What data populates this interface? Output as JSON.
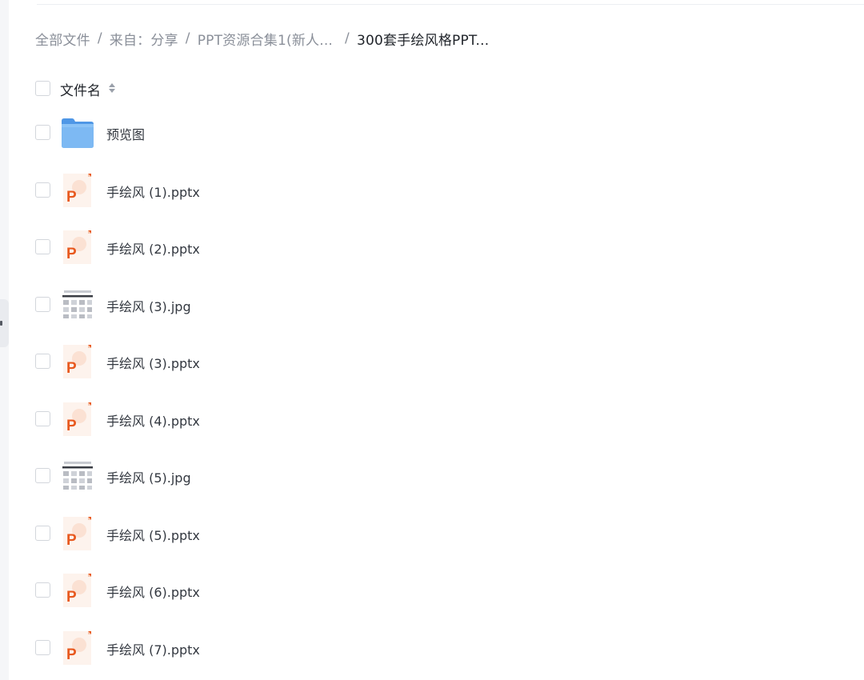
{
  "breadcrumb": {
    "items": [
      "全部文件",
      "来自：分享",
      "PPT资源合集1(新人..."
    ],
    "current": "300套手绘风格PPT...",
    "separator": "/"
  },
  "header": {
    "column_label": "文件名",
    "sort_icon": "sort-icon"
  },
  "files": [
    {
      "name": "预览图",
      "type": "folder"
    },
    {
      "name": "手绘风 (1).pptx",
      "type": "pptx"
    },
    {
      "name": "手绘风 (2).pptx",
      "type": "pptx"
    },
    {
      "name": "手绘风 (3).jpg",
      "type": "jpg"
    },
    {
      "name": "手绘风 (3).pptx",
      "type": "pptx"
    },
    {
      "name": "手绘风 (4).pptx",
      "type": "pptx"
    },
    {
      "name": "手绘风 (5).jpg",
      "type": "jpg"
    },
    {
      "name": "手绘风 (5).pptx",
      "type": "pptx"
    },
    {
      "name": "手绘风 (6).pptx",
      "type": "pptx"
    },
    {
      "name": "手绘风 (7).pptx",
      "type": "pptx"
    }
  ],
  "colors": {
    "folder": "#6fb0f0",
    "ppt_accent": "#e8591f",
    "text_muted": "#8a8f99",
    "text_main": "#1f2329"
  }
}
